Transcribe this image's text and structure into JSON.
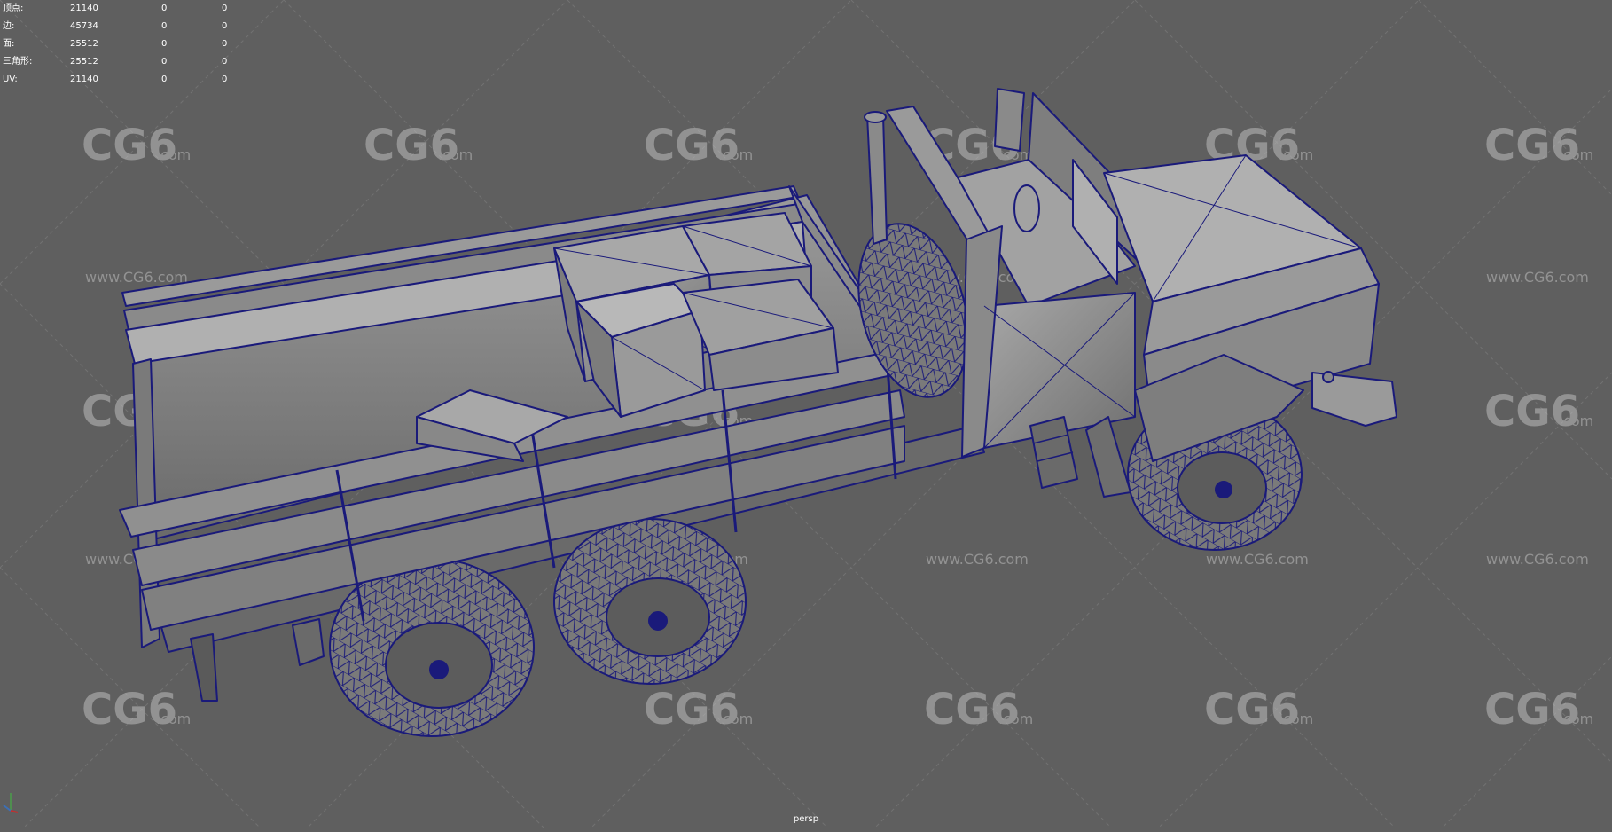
{
  "hud": {
    "rows": [
      {
        "label": "顶点:",
        "values": [
          "21140",
          "0",
          "0"
        ]
      },
      {
        "label": "边:",
        "values": [
          "45734",
          "0",
          "0"
        ]
      },
      {
        "label": "面:",
        "values": [
          "25512",
          "0",
          "0"
        ]
      },
      {
        "label": "三角形:",
        "values": [
          "25512",
          "0",
          "0"
        ]
      },
      {
        "label": "UV:",
        "values": [
          "21140",
          "0",
          "0"
        ]
      }
    ]
  },
  "camera": {
    "name": "persp"
  },
  "watermarks": {
    "logo_text": "CG6",
    "logo_suffix": ".com",
    "url_text": "www.CG6.com"
  },
  "colors": {
    "background": "#5f5f5f",
    "wireframe": "#1a1a7a",
    "shading": "#8c8c8c"
  }
}
